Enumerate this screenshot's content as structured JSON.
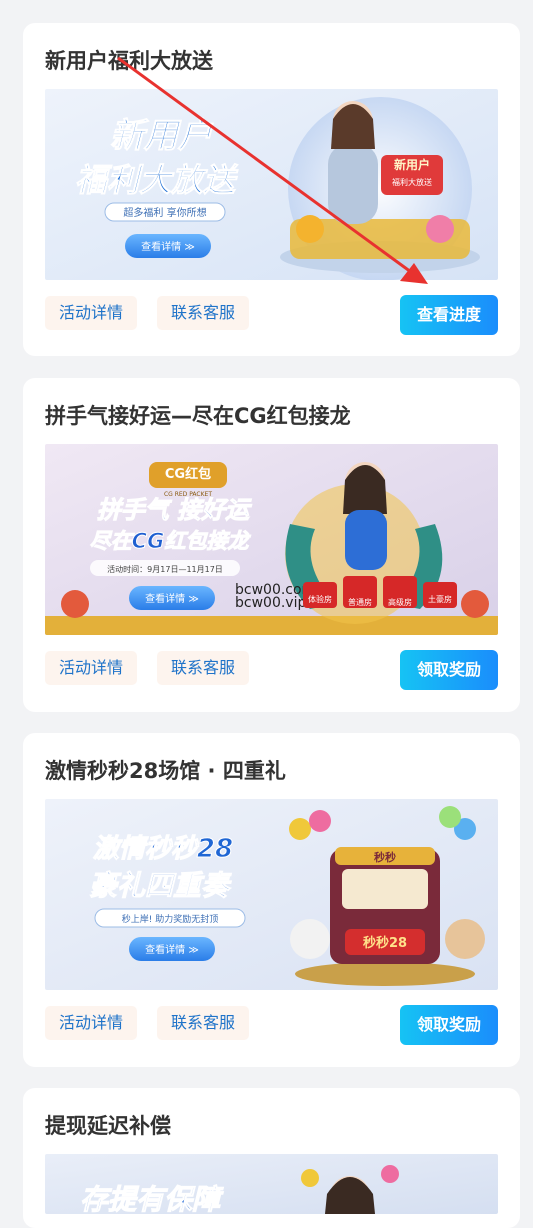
{
  "promotions": [
    {
      "title": "新用户福利大放送",
      "banner": {
        "headline_1": "新用户",
        "headline_2": "福利大放送",
        "tagline": "超多福利 享你所想",
        "button": "查看详情 ≫",
        "badge_1": "新用户",
        "badge_2": "福利大放送"
      },
      "details_label": "活动详情",
      "support_label": "联系客服",
      "action_label": "查看进度"
    },
    {
      "title": "拼手气接好运—尽在CG红包接龙",
      "banner": {
        "logo": "CG红包",
        "logo_sub": "CG RED PACKET",
        "headline_1": "拼手气 接好运",
        "headline_2": "尽在CG红包接龙",
        "date": "活动时间：9月17日—11月17日",
        "button": "查看详情 ≫",
        "watermark_1": "bcw00.com",
        "watermark_2": "bcw00.vip",
        "rooms": [
          "体验房",
          "普通房",
          "高级房",
          "土豪房"
        ]
      },
      "details_label": "活动详情",
      "support_label": "联系客服",
      "action_label": "领取奖励"
    },
    {
      "title": "激情秒秒28场馆 · 四重礼",
      "banner": {
        "headline_1": "激情秒秒28",
        "headline_2": "豪礼四重奏",
        "tagline": "秒上岸! 助力奖励无封顶",
        "button": "查看详情 ≫",
        "sign": "秒秒",
        "game_logo": "秒秒28"
      },
      "details_label": "活动详情",
      "support_label": "联系客服",
      "action_label": "领取奖励"
    },
    {
      "title": "提现延迟补偿",
      "banner": {
        "headline_1": "存提有保障"
      }
    }
  ],
  "colors": {
    "page_bg": "#f2f3f5",
    "card_bg": "#ffffff",
    "chip_bg": "#fdf4ee",
    "chip_text": "#1f73c9",
    "cta_gradient_start": "#16c3f4",
    "cta_gradient_end": "#1a8dfc",
    "annotation_arrow": "#e8322f"
  }
}
